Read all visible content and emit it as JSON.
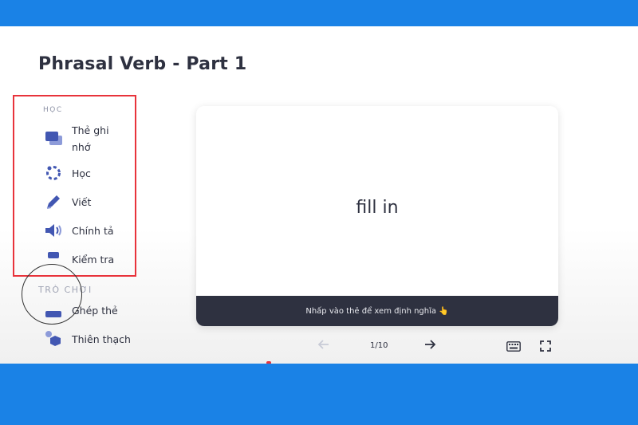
{
  "page": {
    "title": "Phrasal Verb - Part 1"
  },
  "sidebar": {
    "study_label": "HỌC",
    "games_label": "TRÒ CHƠI",
    "items": [
      {
        "label": "Thẻ ghi nhớ",
        "icon": "flashcards-icon"
      },
      {
        "label": "Học",
        "icon": "learn-icon"
      },
      {
        "label": "Viết",
        "icon": "write-icon"
      },
      {
        "label": "Chính tả",
        "icon": "spell-icon"
      },
      {
        "label": "Kiểm tra",
        "icon": "test-icon"
      },
      {
        "label": "Ghép thẻ",
        "icon": "match-icon"
      },
      {
        "label": "Thiên thạch",
        "icon": "gravity-icon"
      }
    ]
  },
  "card": {
    "term": "fill in",
    "hint": "Nhấp vào thẻ để xem định nghĩa 👆"
  },
  "navigation": {
    "counter": "1/10"
  },
  "colors": {
    "accent": "#1a82e6",
    "highlight": "#e8333b",
    "icon": "#4257b2",
    "dark": "#2e3140"
  }
}
